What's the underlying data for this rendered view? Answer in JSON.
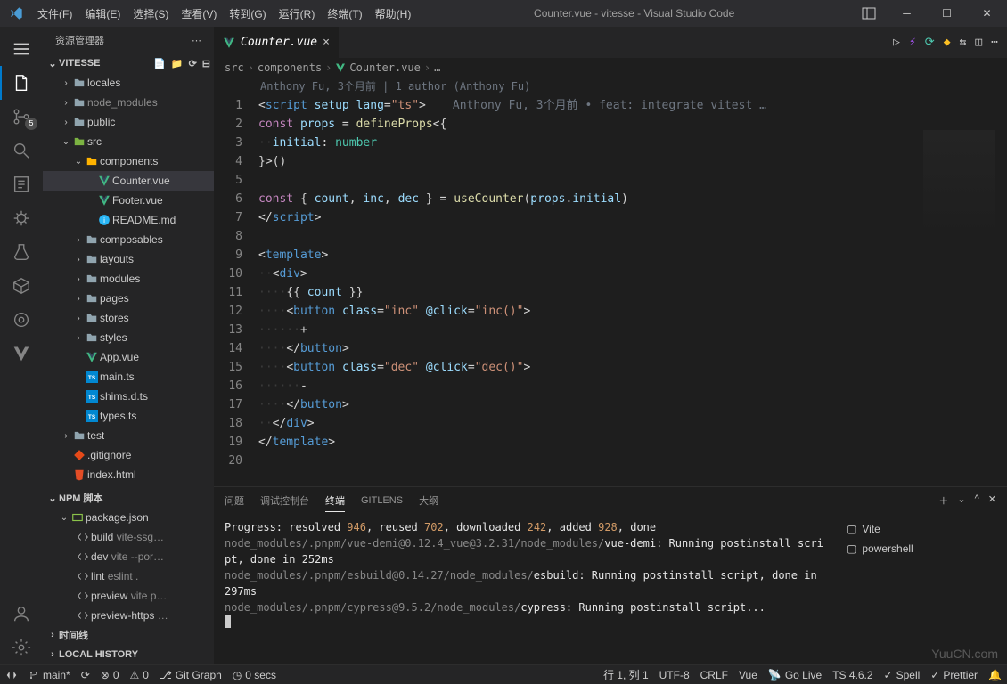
{
  "titlebar": {
    "menu": [
      "文件(F)",
      "编辑(E)",
      "选择(S)",
      "查看(V)",
      "转到(G)",
      "运行(R)",
      "终端(T)",
      "帮助(H)"
    ],
    "title": "Counter.vue - vitesse - Visual Studio Code"
  },
  "activity_badge": "5",
  "sidebar": {
    "title": "资源管理器",
    "project": "VITESSE",
    "tree": [
      {
        "depth": 1,
        "twist": "›",
        "icon": "folder",
        "label": "locales",
        "dim": false
      },
      {
        "depth": 1,
        "twist": "›",
        "icon": "folder",
        "label": "node_modules",
        "dim": true
      },
      {
        "depth": 1,
        "twist": "›",
        "icon": "folder",
        "label": "public",
        "dim": false
      },
      {
        "depth": 1,
        "twist": "⌄",
        "icon": "folder-src",
        "label": "src",
        "dim": false
      },
      {
        "depth": 2,
        "twist": "⌄",
        "icon": "folder-comp",
        "label": "components",
        "dim": false
      },
      {
        "depth": 3,
        "twist": "",
        "icon": "vue",
        "label": "Counter.vue",
        "dim": false,
        "selected": true
      },
      {
        "depth": 3,
        "twist": "",
        "icon": "vue",
        "label": "Footer.vue",
        "dim": false
      },
      {
        "depth": 3,
        "twist": "",
        "icon": "info",
        "label": "README.md",
        "dim": false
      },
      {
        "depth": 2,
        "twist": "›",
        "icon": "folder",
        "label": "composables",
        "dim": false
      },
      {
        "depth": 2,
        "twist": "›",
        "icon": "folder",
        "label": "layouts",
        "dim": false
      },
      {
        "depth": 2,
        "twist": "›",
        "icon": "folder",
        "label": "modules",
        "dim": false
      },
      {
        "depth": 2,
        "twist": "›",
        "icon": "folder",
        "label": "pages",
        "dim": false
      },
      {
        "depth": 2,
        "twist": "›",
        "icon": "folder",
        "label": "stores",
        "dim": false
      },
      {
        "depth": 2,
        "twist": "›",
        "icon": "folder",
        "label": "styles",
        "dim": false
      },
      {
        "depth": 2,
        "twist": "",
        "icon": "vue",
        "label": "App.vue",
        "dim": false
      },
      {
        "depth": 2,
        "twist": "",
        "icon": "ts",
        "label": "main.ts",
        "dim": false
      },
      {
        "depth": 2,
        "twist": "",
        "icon": "ts",
        "label": "shims.d.ts",
        "dim": false
      },
      {
        "depth": 2,
        "twist": "",
        "icon": "ts",
        "label": "types.ts",
        "dim": false
      },
      {
        "depth": 1,
        "twist": "›",
        "icon": "folder",
        "label": "test",
        "dim": false
      },
      {
        "depth": 1,
        "twist": "",
        "icon": "git",
        "label": ".gitignore",
        "dim": false
      },
      {
        "depth": 1,
        "twist": "",
        "icon": "html",
        "label": "index.html",
        "dim": false
      }
    ],
    "npm": {
      "title": "NPM 脚本",
      "package": "package.json",
      "scripts": [
        {
          "name": "build",
          "extra": "vite-ssg…"
        },
        {
          "name": "dev",
          "extra": "vite --por…"
        },
        {
          "name": "lint",
          "extra": "eslint ."
        },
        {
          "name": "preview",
          "extra": "vite p…"
        },
        {
          "name": "preview-https",
          "extra": "…"
        }
      ]
    },
    "sections": [
      "时间线",
      "LOCAL HISTORY"
    ]
  },
  "editor": {
    "tab_name": "Counter.vue",
    "breadcrumb": [
      "src",
      "components",
      "Counter.vue",
      "…"
    ],
    "author_line": "Anthony Fu, 3个月前 | 1 author (Anthony Fu)",
    "inline_blame": "Anthony Fu, 3个月前 • feat: integrate vitest …",
    "line_numbers": [
      1,
      2,
      3,
      4,
      5,
      6,
      7,
      8,
      9,
      10,
      11,
      12,
      13,
      14,
      15,
      16,
      17,
      18,
      19,
      20
    ]
  },
  "panel": {
    "tabs": [
      "问题",
      "调试控制台",
      "终端",
      "GITLENS",
      "大纲"
    ],
    "active_tab": 2,
    "terminal_sessions": [
      "Vite",
      "powershell"
    ],
    "terminal_lines": [
      {
        "segments": [
          {
            "t": "Progress: resolved ",
            "c": "twhite"
          },
          {
            "t": "946",
            "c": "tnum"
          },
          {
            "t": ", reused ",
            "c": "twhite"
          },
          {
            "t": "702",
            "c": "tnum"
          },
          {
            "t": ", downloaded ",
            "c": "twhite"
          },
          {
            "t": "242",
            "c": "tnum"
          },
          {
            "t": ", added ",
            "c": "twhite"
          },
          {
            "t": "928",
            "c": "tnum"
          },
          {
            "t": ", done",
            "c": "twhite"
          }
        ]
      },
      {
        "segments": [
          {
            "t": "node_modules/.pnpm/vue-demi@0.12.4_vue@3.2.31/node_modules/",
            "c": "tgray"
          },
          {
            "t": "vue-demi: Running postinstall script, done in 252ms",
            "c": "twhite"
          }
        ]
      },
      {
        "segments": [
          {
            "t": "node_modules/.pnpm/esbuild@0.14.27/node_modules/",
            "c": "tgray"
          },
          {
            "t": "esbuild: Running postinstall script, done in 297ms",
            "c": "twhite"
          }
        ]
      },
      {
        "segments": [
          {
            "t": "node_modules/.pnpm/cypress@9.5.2/node_modules/",
            "c": "tgray"
          },
          {
            "t": "cypress: Running postinstall script...",
            "c": "twhite"
          }
        ]
      }
    ]
  },
  "statusbar": {
    "left": [
      {
        "icon": "remote",
        "text": ""
      },
      {
        "icon": "branch",
        "text": "main*"
      },
      {
        "icon": "sync",
        "text": ""
      },
      {
        "icon": "error",
        "text": "0"
      },
      {
        "icon": "warn",
        "text": "0"
      },
      {
        "icon": "graph",
        "text": "Git Graph"
      },
      {
        "icon": "clock",
        "text": "0 secs"
      }
    ],
    "right": [
      {
        "text": "行 1, 列 1"
      },
      {
        "text": "UTF-8"
      },
      {
        "text": "CRLF"
      },
      {
        "text": "Vue"
      },
      {
        "icon": "radio",
        "text": "Go Live"
      },
      {
        "text": "TS 4.6.2"
      },
      {
        "icon": "check",
        "text": "Spell"
      },
      {
        "icon": "check",
        "text": "Prettier"
      },
      {
        "icon": "bell",
        "text": ""
      }
    ]
  },
  "watermark": "YuuCN.com"
}
